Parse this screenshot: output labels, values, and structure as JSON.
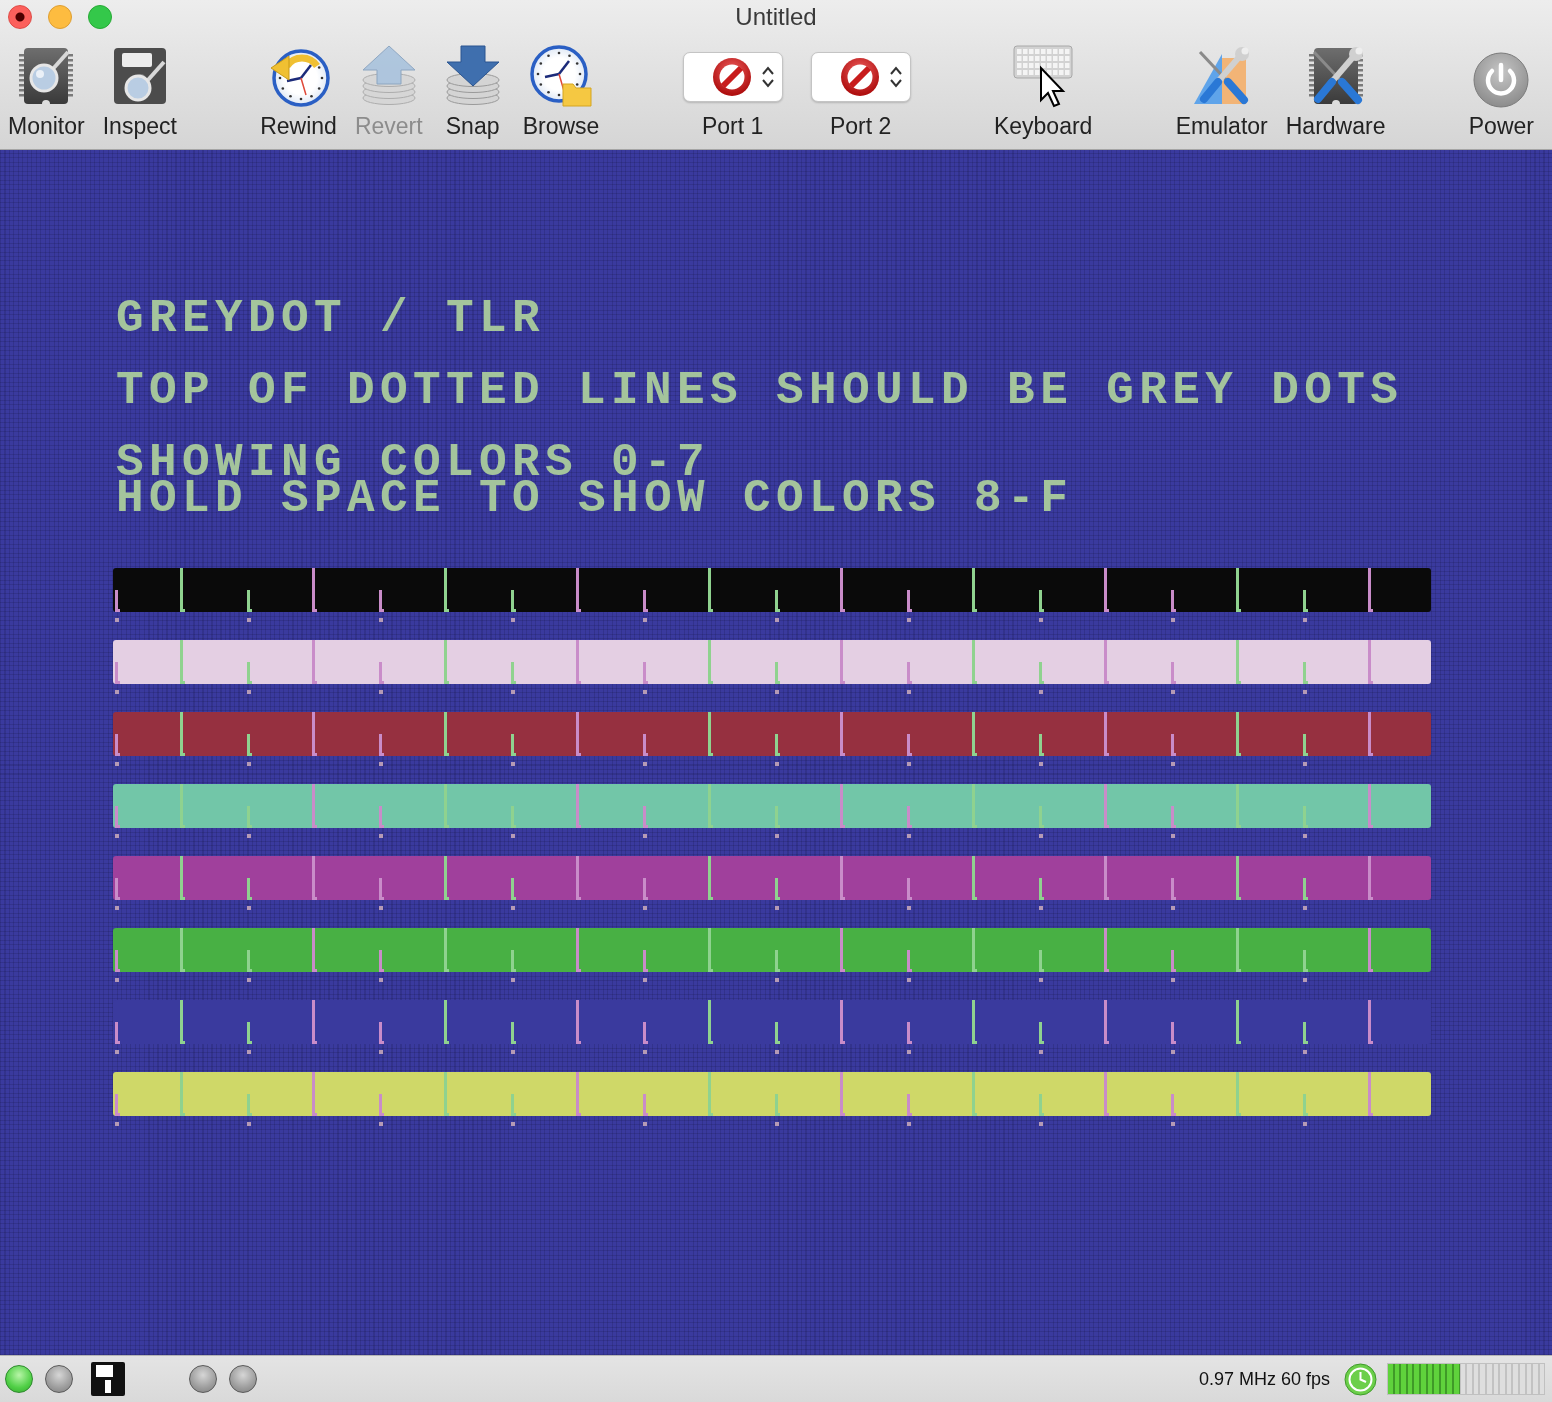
{
  "window": {
    "title": "Untitled"
  },
  "toolbar": {
    "groups": [
      {
        "items": [
          {
            "kind": "button",
            "label": "Monitor",
            "disabled": false
          },
          {
            "kind": "button",
            "label": "Inspect",
            "disabled": false
          }
        ]
      },
      {
        "items": [
          {
            "kind": "button",
            "label": "Rewind",
            "disabled": false
          },
          {
            "kind": "button",
            "label": "Revert",
            "disabled": true
          },
          {
            "kind": "button",
            "label": "Snap",
            "disabled": false
          },
          {
            "kind": "button",
            "label": "Browse",
            "disabled": false
          }
        ]
      },
      {
        "items": [
          {
            "kind": "popup",
            "label": "Port 1"
          },
          {
            "kind": "popup",
            "label": "Port 2"
          }
        ]
      },
      {
        "items": [
          {
            "kind": "button",
            "label": "Keyboard",
            "disabled": false
          }
        ]
      },
      {
        "items": [
          {
            "kind": "button",
            "label": "Emulator",
            "disabled": false
          },
          {
            "kind": "button",
            "label": "Hardware",
            "disabled": false
          }
        ]
      },
      {
        "items": [
          {
            "kind": "button",
            "label": "Power",
            "disabled": false
          }
        ]
      }
    ]
  },
  "screen": {
    "paragraphs": [
      [
        "GREYDOT / TLR"
      ],
      [
        "TOP OF DOTTED LINES SHOULD BE GREY DOTS"
      ],
      [
        "SHOWING COLORS 0-7",
        "HOLD SPACE TO SHOW COLORS 8-F"
      ]
    ],
    "dotted_lines": [
      {
        "color": "#0a0a0a"
      },
      {
        "color": "#e4cfe3"
      },
      {
        "color": "#963040"
      },
      {
        "color": "#72c6a8"
      },
      {
        "color": "#a0409c"
      },
      {
        "color": "#48b044"
      },
      {
        "color": "#3a3a9e"
      },
      {
        "color": "#cfd868"
      }
    ]
  },
  "status_bar": {
    "left_leds": [
      {
        "on": true
      },
      {
        "on": false
      }
    ],
    "drive_leds": [
      {
        "on": false
      },
      {
        "on": false
      }
    ],
    "speed": "0.97 MHz 60 fps",
    "meter": {
      "level": 0.46
    }
  }
}
